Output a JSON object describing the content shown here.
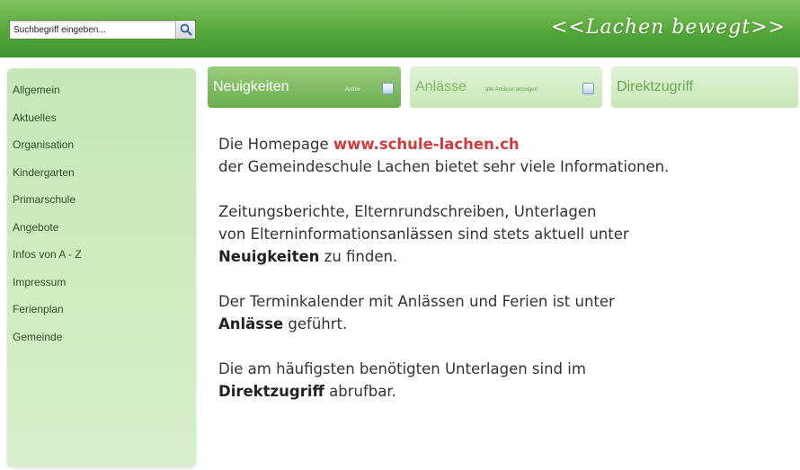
{
  "header": {
    "search_placeholder": "Suchbegriff eingeben...",
    "slogan": "<<Lachen bewegt>>"
  },
  "sidebar": {
    "items": [
      {
        "label": "Allgemein"
      },
      {
        "label": "Aktuelles"
      },
      {
        "label": "Organisation"
      },
      {
        "label": "Kindergarten"
      },
      {
        "label": "Primarschule"
      },
      {
        "label": "Angebote"
      },
      {
        "label": "Infos von A - Z"
      },
      {
        "label": "Impressum"
      },
      {
        "label": "Ferienplan"
      },
      {
        "label": "Gemeinde"
      }
    ]
  },
  "tabs": [
    {
      "label": "Neuigkeiten",
      "sub": "Archiv"
    },
    {
      "label": "Anlässe",
      "sub": "alle Anlässe anzeigen"
    },
    {
      "label": "Direktzugriff"
    }
  ],
  "content": {
    "p1_prefix": "Die Homepage ",
    "p1_link": "www.schule-lachen.ch",
    "p1_rest": "der Gemeindeschule Lachen bietet sehr viele Informationen.",
    "p2_line1": "Zeitungsberichte, Elternrundschreiben, Unterlagen",
    "p2_line2": "von Elterninformationsanlässen sind stets aktuell unter",
    "p2_bold": "Neuigkeiten",
    "p2_suffix": " zu finden.",
    "p3_line1": "Der Terminkalender mit Anlässen und Ferien ist unter",
    "p3_bold": "Anlässe",
    "p3_suffix": " geführt.",
    "p4_line1": "Die am häufigsten benötigten Unterlagen sind im",
    "p4_bold": "Direktzugriff",
    "p4_suffix": " abrufbar."
  },
  "colors": {
    "banner_green": "#56a83a",
    "link_red": "#d43a3a",
    "sidebar_green": "#c6e7b7"
  }
}
